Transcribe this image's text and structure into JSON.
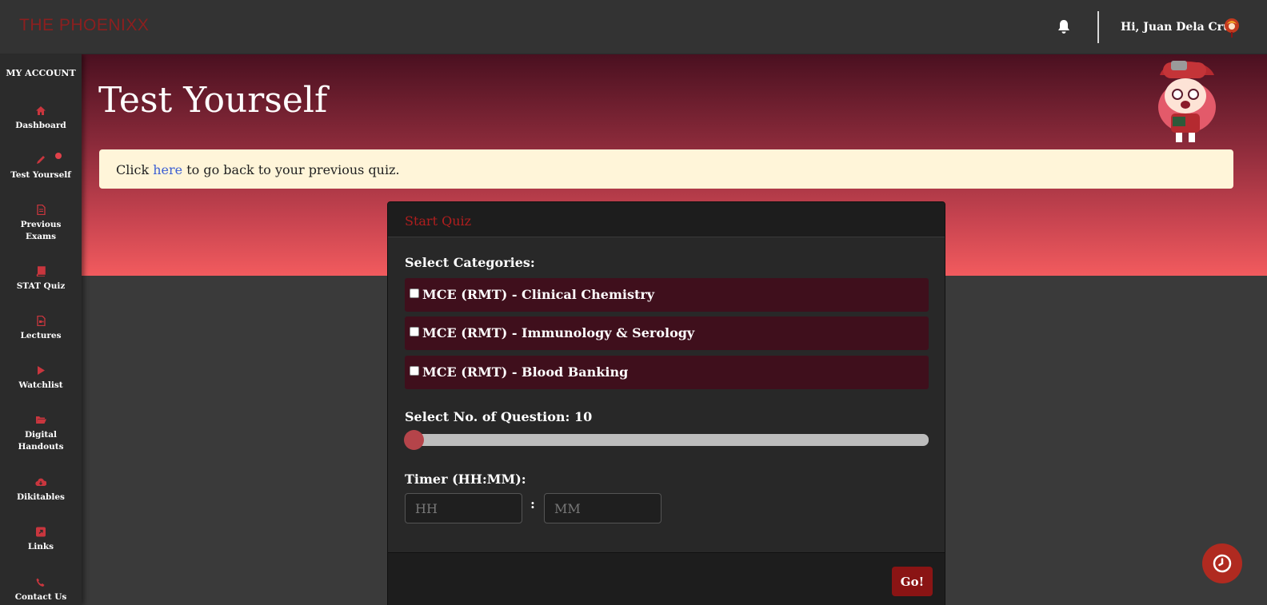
{
  "header": {
    "logo": "THE PHOENIXX",
    "greeting": "Hi, Juan Dela Cruz"
  },
  "sidebar": {
    "title": "MY ACCOUNT",
    "items": [
      {
        "label": "Dashboard",
        "icon": "home-icon"
      },
      {
        "label": "Test Yourself",
        "icon": "pencil-icon"
      },
      {
        "label": "Previous Exams",
        "icon": "file-icon"
      },
      {
        "label": "STAT Quiz",
        "icon": "book-icon"
      },
      {
        "label": "Lectures",
        "icon": "video-file-icon"
      },
      {
        "label": "Watchlist",
        "icon": "play-icon"
      },
      {
        "label": "Digital Handouts",
        "icon": "folder-open-icon"
      },
      {
        "label": "Dikitables",
        "icon": "cloud-download-icon"
      },
      {
        "label": "Links",
        "icon": "external-link-icon"
      },
      {
        "label": "Contact Us",
        "icon": "phone-icon"
      }
    ]
  },
  "page": {
    "title": "Test Yourself",
    "alert_prefix": "Click ",
    "alert_link": "here",
    "alert_suffix": " to go back to your previous quiz."
  },
  "quiz": {
    "header": "Start Quiz",
    "categories_label": "Select Categories:",
    "categories": [
      "MCE (RMT) - Clinical Chemistry",
      "MCE (RMT) - Immunology & Serology",
      "MCE (RMT) - Blood Banking"
    ],
    "questions_label": "Select No. of Question: 10",
    "questions_value": 10,
    "timer_label": "Timer (HH:MM):",
    "hh_placeholder": "HH",
    "mm_placeholder": "MM",
    "colon": ":",
    "go_label": "Go!"
  },
  "colors": {
    "accent": "#8a1414",
    "hero_top": "#4a1020",
    "hero_bottom": "#f25b5e",
    "alert_bg": "#fff5d9",
    "category_bg": "#3f0f1c"
  }
}
